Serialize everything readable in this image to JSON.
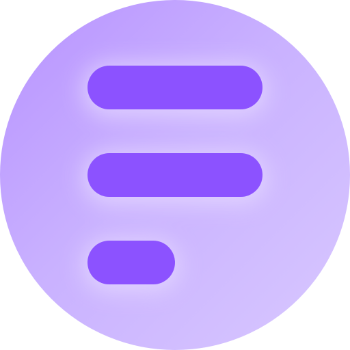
{
  "icon": {
    "name": "menu-lines-icon",
    "colors": {
      "circle_light": "#D8C8FF",
      "circle_mid": "#C9B1FF",
      "circle_dark": "#B792FF",
      "bar": "#8C52FF",
      "bar_glow": "#E6D9FF"
    }
  }
}
